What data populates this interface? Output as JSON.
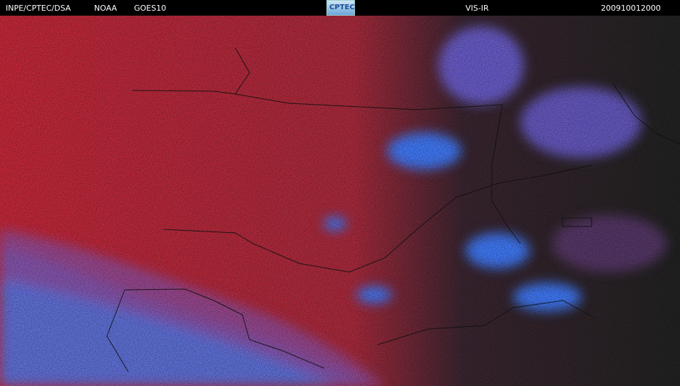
{
  "header": {
    "institution": "INPE/CPTEC/DSA",
    "agency": "NOAA",
    "satellite": "GOES10",
    "logo_text": "CPTEC",
    "product": "VIS-IR",
    "timestamp": "200910012000"
  },
  "colors": {
    "background": "#000000",
    "land_red": "#c4283a",
    "cloud_blue": "#4f7df2",
    "haze_purple": "#8d4fa3",
    "night_dark": "#262626"
  }
}
